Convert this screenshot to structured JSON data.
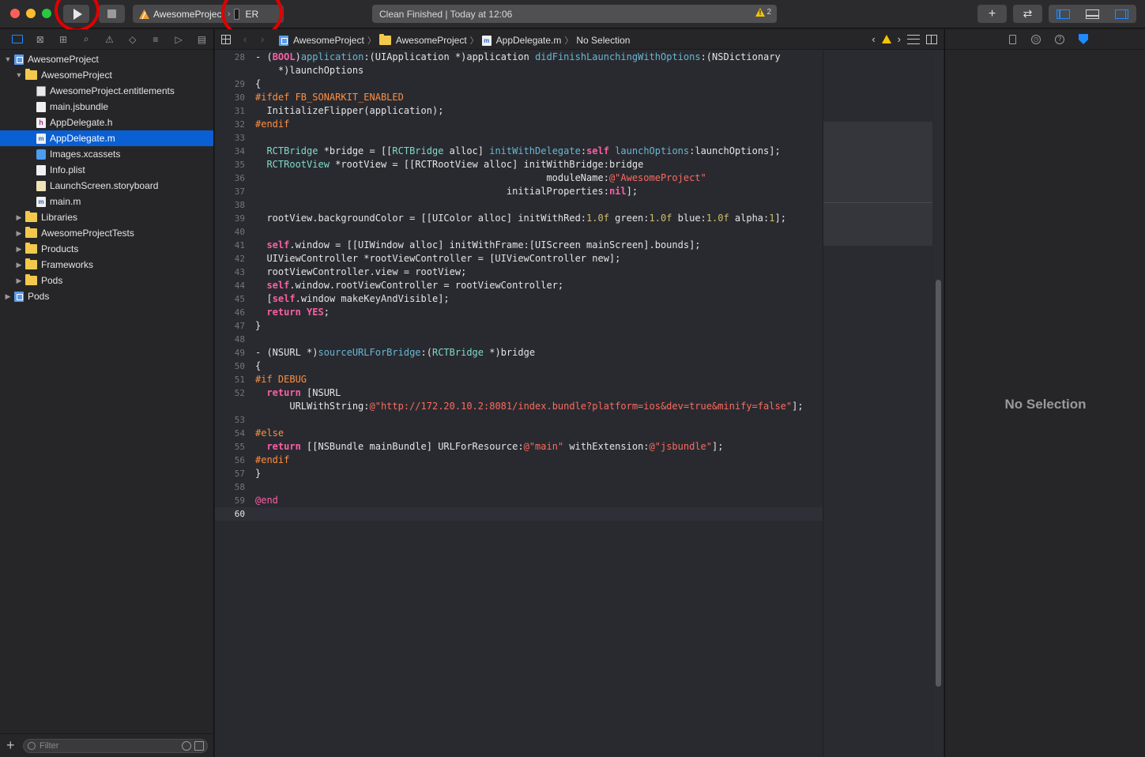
{
  "toolbar": {
    "scheme_name": "AwesomeProject",
    "device_name": "ER",
    "status_text": "Clean Finished | Today at 12:06",
    "warning_count": "2",
    "add_label": "+",
    "swap_label": "⇄"
  },
  "navigator": {
    "tabs": [
      "folder-icon",
      "source-control-icon",
      "symbol-icon",
      "search-icon",
      "issue-icon",
      "test-icon",
      "debug-icon",
      "breakpoint-icon",
      "report-icon"
    ],
    "items": [
      {
        "label": "AwesomeProject",
        "depth": 0,
        "type": "proj",
        "disclosure": "open"
      },
      {
        "label": "AwesomeProject",
        "depth": 1,
        "type": "folder",
        "disclosure": "open"
      },
      {
        "label": "AwesomeProject.entitlements",
        "depth": 2,
        "type": "ent"
      },
      {
        "label": "main.jsbundle",
        "depth": 2,
        "type": "doc"
      },
      {
        "label": "AppDelegate.h",
        "depth": 2,
        "type": "hfile"
      },
      {
        "label": "AppDelegate.m",
        "depth": 2,
        "type": "mfile",
        "selected": true
      },
      {
        "label": "Images.xcassets",
        "depth": 2,
        "type": "asset"
      },
      {
        "label": "Info.plist",
        "depth": 2,
        "type": "plist"
      },
      {
        "label": "LaunchScreen.storyboard",
        "depth": 2,
        "type": "board"
      },
      {
        "label": "main.m",
        "depth": 2,
        "type": "mfile"
      },
      {
        "label": "Libraries",
        "depth": 1,
        "type": "folder",
        "disclosure": "closed"
      },
      {
        "label": "AwesomeProjectTests",
        "depth": 1,
        "type": "folder",
        "disclosure": "closed"
      },
      {
        "label": "Products",
        "depth": 1,
        "type": "folder",
        "disclosure": "closed"
      },
      {
        "label": "Frameworks",
        "depth": 1,
        "type": "folder",
        "disclosure": "closed"
      },
      {
        "label": "Pods",
        "depth": 1,
        "type": "folder",
        "disclosure": "closed"
      },
      {
        "label": "Pods",
        "depth": 0,
        "type": "proj",
        "disclosure": "closed"
      }
    ],
    "filter_placeholder": "Filter"
  },
  "jumpbar": {
    "crumbs": [
      {
        "label": "AwesomeProject",
        "type": "proj"
      },
      {
        "label": "AwesomeProject",
        "type": "folder"
      },
      {
        "label": "AppDelegate.m",
        "type": "mfile"
      },
      {
        "label": "No Selection",
        "type": "none"
      }
    ]
  },
  "code": {
    "current_line": "60",
    "lines": [
      {
        "n": "28",
        "parts": [
          [
            "- (",
            ""
          ],
          [
            "BOOL",
            "kw"
          ],
          [
            ")",
            ""
          ],
          [
            "application",
            "fn"
          ],
          [
            ":(UIApplication *)application ",
            ""
          ],
          [
            "didFinishLaunchingWithOptions",
            "fn"
          ],
          [
            ":(NSDictionary",
            ""
          ]
        ]
      },
      {
        "n": "",
        "parts": [
          [
            "    *)launchOptions",
            ""
          ]
        ]
      },
      {
        "n": "29",
        "parts": [
          [
            "{",
            ""
          ]
        ]
      },
      {
        "n": "30",
        "parts": [
          [
            "#ifdef FB_SONARKIT_ENABLED",
            "pp"
          ]
        ]
      },
      {
        "n": "31",
        "parts": [
          [
            "  InitializeFlipper(application);",
            ""
          ]
        ]
      },
      {
        "n": "32",
        "parts": [
          [
            "#endif",
            "pp"
          ]
        ]
      },
      {
        "n": "33",
        "parts": []
      },
      {
        "n": "34",
        "parts": [
          [
            "  ",
            ""
          ],
          [
            "RCTBridge",
            "ty"
          ],
          [
            " *bridge = [[",
            ""
          ],
          [
            "RCTBridge",
            "ty"
          ],
          [
            " alloc] ",
            ""
          ],
          [
            "initWithDelegate",
            "fn"
          ],
          [
            ":",
            ""
          ],
          [
            "self",
            "kw"
          ],
          [
            " ",
            ""
          ],
          [
            "launchOptions",
            "fn"
          ],
          [
            ":launchOptions];",
            ""
          ]
        ]
      },
      {
        "n": "35",
        "parts": [
          [
            "  ",
            ""
          ],
          [
            "RCTRootView",
            "ty"
          ],
          [
            " *rootView = [[RCTRootView alloc] initWithBridge:bridge",
            ""
          ]
        ]
      },
      {
        "n": "36",
        "parts": [
          [
            "                                                   moduleName:",
            ""
          ],
          [
            "@\"AwesomeProject\"",
            "st"
          ]
        ]
      },
      {
        "n": "37",
        "parts": [
          [
            "                                            initialProperties:",
            ""
          ],
          [
            "nil",
            "kw"
          ],
          [
            "];",
            ""
          ]
        ]
      },
      {
        "n": "38",
        "parts": []
      },
      {
        "n": "39",
        "parts": [
          [
            "  rootView.backgroundColor = [[UIColor alloc] initWithRed:",
            ""
          ],
          [
            "1.0f",
            "nm"
          ],
          [
            " green:",
            ""
          ],
          [
            "1.0f",
            "nm"
          ],
          [
            " blue:",
            ""
          ],
          [
            "1.0f",
            "nm"
          ],
          [
            " alpha:",
            ""
          ],
          [
            "1",
            "nm"
          ],
          [
            "];",
            ""
          ]
        ]
      },
      {
        "n": "40",
        "parts": []
      },
      {
        "n": "41",
        "parts": [
          [
            "  ",
            ""
          ],
          [
            "self",
            "kw"
          ],
          [
            ".window = [[UIWindow alloc] initWithFrame:[UIScreen mainScreen].bounds];",
            ""
          ]
        ]
      },
      {
        "n": "42",
        "parts": [
          [
            "  UIViewController *rootViewController = [UIViewController new];",
            ""
          ]
        ]
      },
      {
        "n": "43",
        "parts": [
          [
            "  rootViewController.view = rootView;",
            ""
          ]
        ]
      },
      {
        "n": "44",
        "parts": [
          [
            "  ",
            ""
          ],
          [
            "self",
            "kw"
          ],
          [
            ".window.rootViewController = rootViewController;",
            ""
          ]
        ]
      },
      {
        "n": "45",
        "parts": [
          [
            "  [",
            ""
          ],
          [
            "self",
            "kw"
          ],
          [
            ".window makeKeyAndVisible];",
            ""
          ]
        ]
      },
      {
        "n": "46",
        "parts": [
          [
            "  ",
            ""
          ],
          [
            "return",
            "kw"
          ],
          [
            " ",
            ""
          ],
          [
            "YES",
            "kw"
          ],
          [
            ";",
            ""
          ]
        ]
      },
      {
        "n": "47",
        "parts": [
          [
            "}",
            ""
          ]
        ]
      },
      {
        "n": "48",
        "parts": []
      },
      {
        "n": "49",
        "parts": [
          [
            "- (NSURL *)",
            ""
          ],
          [
            "sourceURLForBridge",
            "fn"
          ],
          [
            ":(",
            ""
          ],
          [
            "RCTBridge",
            "ty"
          ],
          [
            " *)bridge",
            ""
          ]
        ]
      },
      {
        "n": "50",
        "parts": [
          [
            "{",
            ""
          ]
        ]
      },
      {
        "n": "51",
        "parts": [
          [
            "#if DEBUG",
            "pp"
          ]
        ]
      },
      {
        "n": "52",
        "parts": [
          [
            "  ",
            ""
          ],
          [
            "return",
            "kw"
          ],
          [
            " [NSURL",
            ""
          ]
        ]
      },
      {
        "n": "",
        "parts": [
          [
            "      URLWithString:",
            ""
          ],
          [
            "@\"http://172.20.10.2:8081/index.bundle?platform=ios&dev=true&minify=false\"",
            "st"
          ],
          [
            "];",
            ""
          ]
        ]
      },
      {
        "n": "53",
        "parts": []
      },
      {
        "n": "54",
        "parts": [
          [
            "#else",
            "pp"
          ]
        ]
      },
      {
        "n": "55",
        "parts": [
          [
            "  ",
            ""
          ],
          [
            "return",
            "kw"
          ],
          [
            " [[NSBundle mainBundle] URLForResource:",
            ""
          ],
          [
            "@\"main\"",
            "st"
          ],
          [
            " withExtension:",
            ""
          ],
          [
            "@\"jsbundle\"",
            "st"
          ],
          [
            "];",
            ""
          ]
        ]
      },
      {
        "n": "56",
        "parts": [
          [
            "#endif",
            "pp"
          ]
        ]
      },
      {
        "n": "57",
        "parts": [
          [
            "}",
            ""
          ]
        ]
      },
      {
        "n": "58",
        "parts": []
      },
      {
        "n": "59",
        "parts": [
          [
            "@end",
            "at"
          ]
        ]
      },
      {
        "n": "60",
        "parts": []
      }
    ]
  },
  "inspector": {
    "tabs": [
      "file-inspector-icon",
      "history-icon",
      "help-icon",
      "attributes-icon"
    ],
    "empty_label": "No Selection"
  },
  "colors": {
    "accent": "#1e8bff",
    "selection": "#0a5fd3",
    "annotation": "#e00000",
    "warning": "#f5c400"
  }
}
